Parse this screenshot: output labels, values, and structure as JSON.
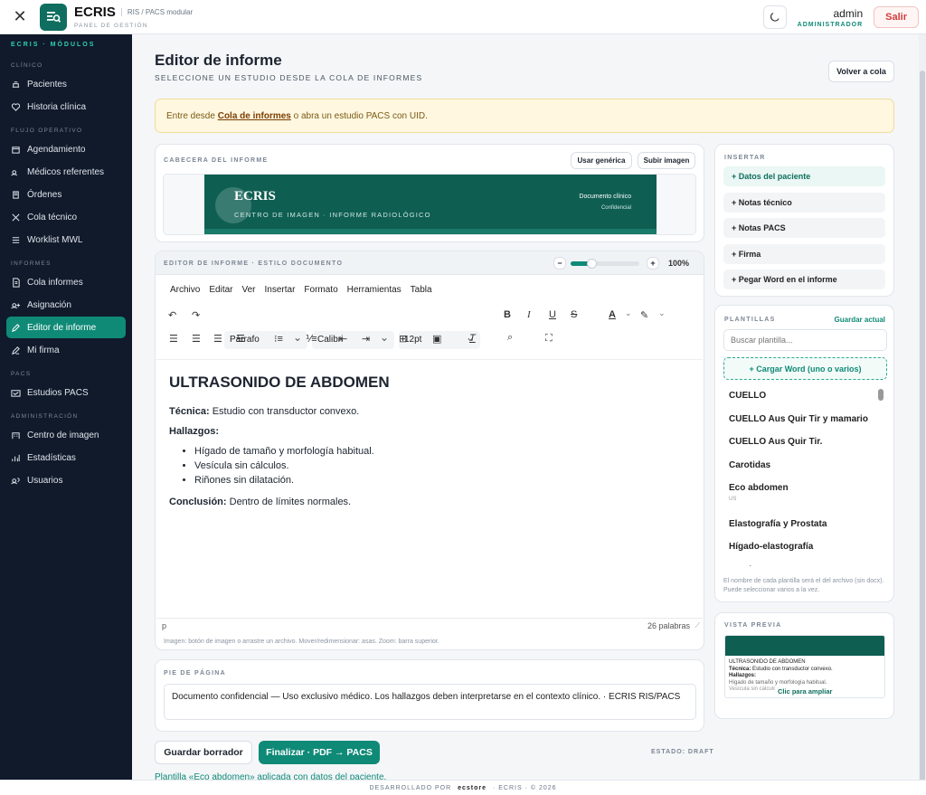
{
  "topbar": {
    "close": "✕",
    "brand": "ECRIS",
    "subtitle": "RIS / PACS modular",
    "panel": "PANEL DE GESTIÓN",
    "user": "admin",
    "role": "ADMINISTRADOR",
    "logout": "Salir"
  },
  "sidebar": {
    "head": "ECRIS · MÓDULOS",
    "sections": [
      {
        "title": "CLÍNICO",
        "items": [
          "Pacientes",
          "Historia clínica"
        ]
      },
      {
        "title": "FLUJO OPERATIVO",
        "items": [
          "Agendamiento",
          "Médicos referentes",
          "Órdenes",
          "Cola técnico",
          "Worklist MWL"
        ]
      },
      {
        "title": "INFORMES",
        "items": [
          "Cola informes",
          "Asignación",
          "Editor de informe",
          "Mi firma"
        ]
      },
      {
        "title": "PACS",
        "items": [
          "Estudios PACS"
        ]
      },
      {
        "title": "ADMINISTRACIÓN",
        "items": [
          "Centro de imagen",
          "Estadísticas",
          "Usuarios"
        ]
      }
    ]
  },
  "page": {
    "title": "Editor de informe",
    "subtitle": "SELECCIONE UN ESTUDIO DESDE LA COLA DE INFORMES",
    "back": "Volver a cola"
  },
  "alert": {
    "pre": "Entre desde ",
    "link": "Cola de informes",
    "post": " o abra un estudio PACS con UID."
  },
  "header_card": {
    "label": "CABECERA DEL INFORME",
    "generic": "Usar genérica",
    "upload": "Subir imagen",
    "banner_title": "ECRIS",
    "banner_sub": "CENTRO DE IMAGEN · INFORME RADIOLÓGICO",
    "banner_r1": "Documento clínico",
    "banner_r2": "Confidencial"
  },
  "editor": {
    "label": "EDITOR DE INFORME · ESTILO DOCUMENTO",
    "zoom_minus": "−",
    "zoom_plus": "+",
    "zoom": "100%",
    "zoom_fraction": 0.3,
    "menu": [
      "Archivo",
      "Editar",
      "Ver",
      "Insertar",
      "Formato",
      "Herramientas",
      "Tabla"
    ],
    "block": "Párrafo",
    "font": "Calibri",
    "size": "12pt",
    "doc": {
      "h1": "ULTRASONIDO DE ABDOMEN",
      "tec_label": "Técnica:",
      "tec": " Estudio con transductor convexo.",
      "hall": "Hallazgos:",
      "list": [
        "Hígado de tamaño y morfología habitual.",
        "Vesícula sin cálculos.",
        "Riñones sin dilatación."
      ],
      "conc_label": "Conclusión:",
      "conc": " Dentro de límites normales."
    },
    "status_left": "p",
    "words": "26 palabras",
    "hint": "Imagen: botón de imagen o arrastre un archivo. Mover/redimensionar: asas. Zoom: barra superior."
  },
  "footer_card": {
    "label": "PIE DE PÁGINA",
    "text": "Documento confidencial — Uso exclusivo médico. Los hallazgos deben interpretarse en el contexto clínico. · ECRIS RIS/PACS"
  },
  "actions": {
    "draft": "Guardar borrador",
    "finalize": "Finalizar · PDF → PACS",
    "state": "ESTADO: DRAFT",
    "applied": "Plantilla «Eco abdomen» aplicada con datos del paciente."
  },
  "insert": {
    "label": "INSERTAR",
    "items": [
      "+ Datos del paciente",
      "+ Notas técnico",
      "+ Notas PACS",
      "+ Firma",
      "+ Pegar Word en el informe"
    ]
  },
  "templates": {
    "label": "PLANTILLAS",
    "save": "Guardar actual",
    "search_placeholder": "Buscar plantilla...",
    "load": "+ Cargar Word (uno o varios)",
    "items": [
      {
        "name": "CUELLO"
      },
      {
        "name": "CUELLO Aus Quir Tir y mamario"
      },
      {
        "name": "CUELLO Aus Quir Tir."
      },
      {
        "name": "Carotidas"
      },
      {
        "name": "Eco abdomen",
        "tag": "US"
      },
      {
        "name": "Elastografía y Prostata"
      },
      {
        "name": "Hígado-elastografía"
      },
      {
        "name": "Hombro"
      }
    ],
    "note": "El nombre de cada plantilla será el del archivo (sin docx). Puede seleccionar varios a la vez."
  },
  "preview": {
    "label": "VISTA PREVIA",
    "title": "ULTRASONIDO DE ABDOMEN",
    "l1a": "Técnica:",
    "l1b": " Estudio con transductor convexo.",
    "l2": "Hallazgos:",
    "l3": "Hígado de tamaño y morfología habitual.",
    "l4": "Vesícula sin cálculos.",
    "zoom": "Clic para ampliar"
  },
  "footer": {
    "pre": "DESARROLLADO POR",
    "brand": "ecstore",
    "post": "· ECRIS · © 2026"
  },
  "colors": {
    "accent": "#0f8a77",
    "sidebar": "#101a2b",
    "banner": "#0f5e52"
  }
}
